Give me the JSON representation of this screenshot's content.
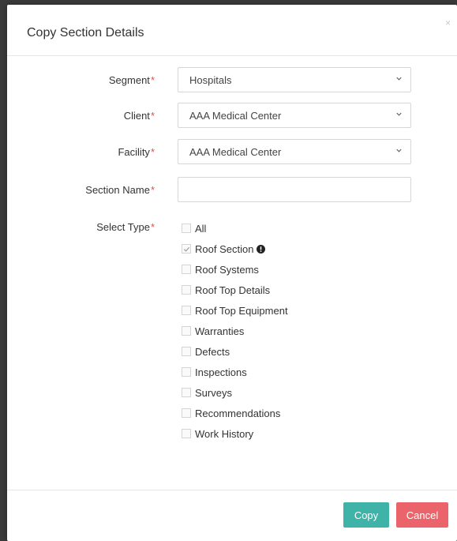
{
  "dialog": {
    "title": "Copy Section Details",
    "close_symbol": "×"
  },
  "form": {
    "required_marker": "*",
    "segment": {
      "label": "Segment",
      "value": "Hospitals"
    },
    "client": {
      "label": "Client",
      "value": "AAA Medical Center"
    },
    "facility": {
      "label": "Facility",
      "value": "AAA Medical Center"
    },
    "section_name": {
      "label": "Section Name",
      "value": ""
    },
    "select_type": {
      "label": "Select Type",
      "options": [
        {
          "label": "All",
          "checked": false
        },
        {
          "label": "Roof Section",
          "checked": true,
          "info_icon": "exclamation-circle-icon"
        },
        {
          "label": "Roof Systems",
          "checked": false
        },
        {
          "label": "Roof Top Details",
          "checked": false
        },
        {
          "label": "Roof Top Equipment",
          "checked": false
        },
        {
          "label": "Warranties",
          "checked": false
        },
        {
          "label": "Defects",
          "checked": false
        },
        {
          "label": "Inspections",
          "checked": false
        },
        {
          "label": "Surveys",
          "checked": false
        },
        {
          "label": "Recommendations",
          "checked": false
        },
        {
          "label": "Work History",
          "checked": false
        }
      ]
    }
  },
  "footer": {
    "copy_label": "Copy",
    "cancel_label": "Cancel"
  },
  "colors": {
    "required": "#d9534f",
    "copy_button": "#3fb3a8",
    "cancel_button": "#ec646b"
  }
}
